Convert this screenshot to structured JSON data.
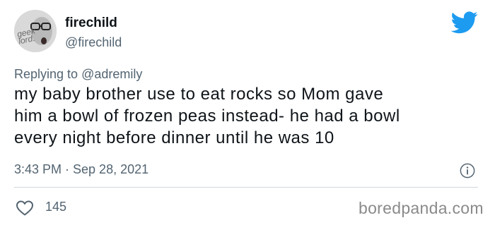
{
  "tweet": {
    "avatar_text": "geek\nlord.",
    "display_name": "firechild",
    "handle": "@firechild",
    "replying_prefix": "Replying to",
    "replying_to": "@adremily",
    "text_lines": [
      "my baby brother use to eat rocks so Mom gave",
      "him a bowl of frozen peas instead- he had a bowl",
      "every night before dinner until he was 10"
    ],
    "timestamp": "3:43 PM · Sep 28, 2021",
    "like_count": "145"
  },
  "icons": {
    "brand": "twitter-bird-icon",
    "info": "info-icon",
    "like": "heart-icon"
  },
  "watermark": "boredpanda.com",
  "colors": {
    "twitter_blue": "#1d9bf0",
    "text_primary": "#0f1419",
    "text_secondary": "#536471",
    "divider": "#cfd9de"
  }
}
